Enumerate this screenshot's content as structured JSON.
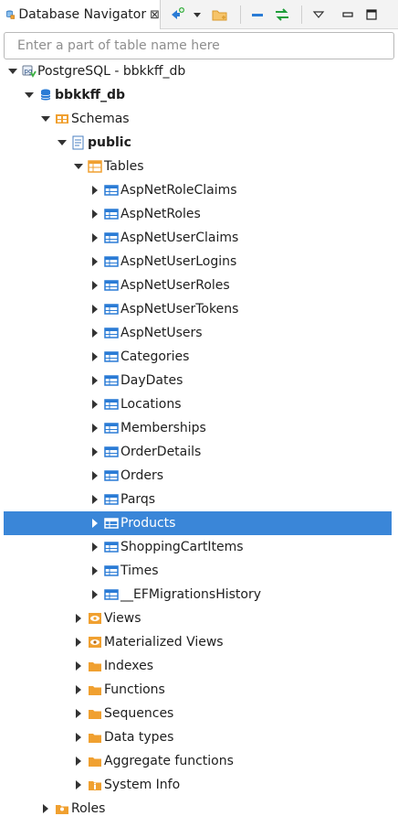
{
  "view": {
    "title": "Database Navigator",
    "close_glyph": "⊠"
  },
  "search": {
    "placeholder": "Enter a part of table name here",
    "value": ""
  },
  "toolbar": {
    "icons": [
      "new-connection-icon",
      "dropdown-arrow-icon",
      "new-folder-icon",
      "collapse-all-icon",
      "link-with-editor-icon",
      "view-menu-icon",
      "minimize-icon",
      "maximize-icon"
    ]
  },
  "colors": {
    "selection": "#3a86d8",
    "table_icon": "#2a7bd5",
    "folder": "#f0a030",
    "database": "#2a7bd5"
  },
  "tree": {
    "connection": "PostgreSQL - bbkkff_db",
    "database": "bbkkff_db",
    "schemas": "Schemas",
    "schema": "public",
    "tables_folder": "Tables",
    "tables": [
      "AspNetRoleClaims",
      "AspNetRoles",
      "AspNetUserClaims",
      "AspNetUserLogins",
      "AspNetUserRoles",
      "AspNetUserTokens",
      "AspNetUsers",
      "Categories",
      "DayDates",
      "Locations",
      "Memberships",
      "OrderDetails",
      "Orders",
      "Parqs",
      "Products",
      "ShoppingCartItems",
      "Times",
      "__EFMigrationsHistory"
    ],
    "selected_table": "Products",
    "schema_children": [
      {
        "label": "Views",
        "icon": "views-icon"
      },
      {
        "label": "Materialized Views",
        "icon": "materialized-views-icon"
      },
      {
        "label": "Indexes",
        "icon": "folder-icon"
      },
      {
        "label": "Functions",
        "icon": "folder-icon"
      },
      {
        "label": "Sequences",
        "icon": "folder-icon"
      },
      {
        "label": "Data types",
        "icon": "folder-icon"
      },
      {
        "label": "Aggregate functions",
        "icon": "folder-icon"
      },
      {
        "label": "System Info",
        "icon": "system-info-icon"
      }
    ],
    "roles": "Roles"
  }
}
